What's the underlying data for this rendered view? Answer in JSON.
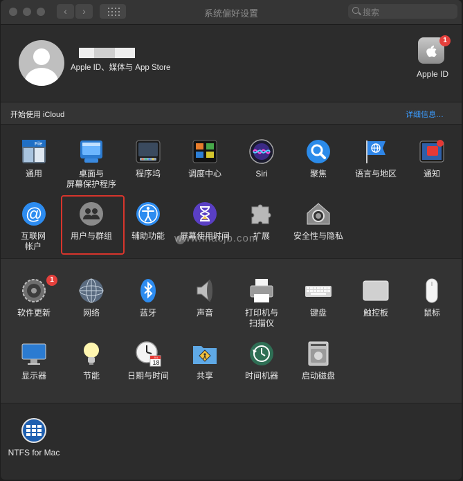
{
  "window": {
    "title": "系统偏好设置"
  },
  "toolbar": {
    "back_label": "‹",
    "forward_label": "›"
  },
  "search": {
    "placeholder": "搜索"
  },
  "account": {
    "subtitle": "Apple ID、媒体与 App Store"
  },
  "appleid": {
    "label": "Apple ID",
    "badge": "1"
  },
  "icloud_banner": {
    "text": "开始使用 iCloud",
    "link": "详细信息…"
  },
  "row1": [
    {
      "label": "通用"
    },
    {
      "label": "桌面与\n屏幕保护程序"
    },
    {
      "label": "程序坞"
    },
    {
      "label": "调度中心"
    },
    {
      "label": "Siri"
    },
    {
      "label": "聚焦"
    },
    {
      "label": "语言与地区"
    },
    {
      "label": "通知"
    }
  ],
  "row2": [
    {
      "label": "互联网\n帐户"
    },
    {
      "label": "用户与群组"
    },
    {
      "label": "辅助功能"
    },
    {
      "label": "屏幕使用时间"
    },
    {
      "label": "扩展"
    },
    {
      "label": "安全性与隐私"
    }
  ],
  "row3": [
    {
      "label": "软件更新",
      "badge": "1"
    },
    {
      "label": "网络"
    },
    {
      "label": "蓝牙"
    },
    {
      "label": "声音"
    },
    {
      "label": "打印机与\n扫描仪"
    },
    {
      "label": "键盘"
    },
    {
      "label": "触控板"
    },
    {
      "label": "鼠标"
    }
  ],
  "row4": [
    {
      "label": "显示器"
    },
    {
      "label": "节能"
    },
    {
      "label": "日期与时间"
    },
    {
      "label": "共享"
    },
    {
      "label": "时间机器"
    },
    {
      "label": "启动磁盘"
    }
  ],
  "row5": [
    {
      "label": "NTFS for Mac"
    }
  ],
  "calendar": {
    "month": "JUL",
    "day": "18"
  },
  "watermark": {
    "text": "www.macjb.com"
  },
  "colors": {
    "accent": "#3b9cff",
    "badge": "#e5403c",
    "highlight": "#d8352c"
  }
}
